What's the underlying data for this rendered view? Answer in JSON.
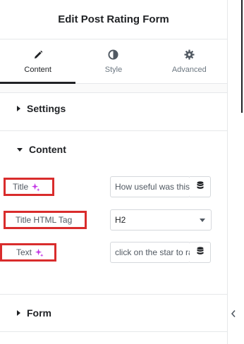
{
  "header": {
    "title": "Edit Post Rating Form"
  },
  "tabs": [
    {
      "label": "Content",
      "icon": "pencil-icon",
      "active": true
    },
    {
      "label": "Style",
      "icon": "half-circle-icon",
      "active": false
    },
    {
      "label": "Advanced",
      "icon": "gear-icon",
      "active": false
    }
  ],
  "sections": {
    "settings": {
      "label": "Settings",
      "expanded": false
    },
    "content": {
      "label": "Content",
      "expanded": true
    },
    "form": {
      "label": "Form",
      "expanded": false
    }
  },
  "fields": {
    "title": {
      "label": "Title",
      "value": "How useful was this post?"
    },
    "title_html_tag": {
      "label": "Title HTML Tag",
      "value": "H2"
    },
    "text": {
      "label": "Text",
      "value": "click on the star to rate it"
    }
  },
  "colors": {
    "highlight": "#d92c2c",
    "ai_accent": "#c336e5",
    "active_tab": "#1f2124"
  }
}
